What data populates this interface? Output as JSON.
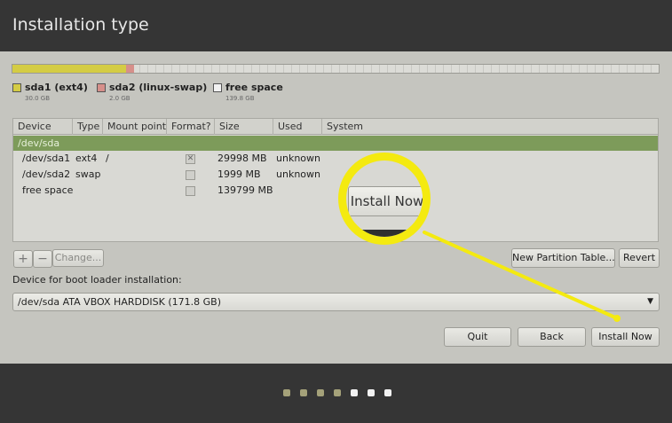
{
  "window": {
    "title": "Installation type"
  },
  "partition_bar": {
    "segments": [
      {
        "name": "sda1 (ext4)",
        "size": "30.0 GB",
        "color": "#d4cc44",
        "fraction": 0.176
      },
      {
        "name": "sda2 (linux-swap)",
        "size": "2.0 GB",
        "color": "#d68f8a",
        "fraction": 0.012
      },
      {
        "name": "free space",
        "size": "139.8 GB",
        "color": "#f2f2f2",
        "fraction": 0.812
      }
    ]
  },
  "table": {
    "headers": [
      "Device",
      "Type",
      "Mount point",
      "Format?",
      "Size",
      "Used",
      "System"
    ],
    "group": "/dev/sda",
    "rows": [
      {
        "device": "/dev/sda1",
        "type": "ext4",
        "mount": "/",
        "format": "✕",
        "size": "29998 MB",
        "used": "unknown"
      },
      {
        "device": "/dev/sda2",
        "type": "swap",
        "mount": "",
        "format": "",
        "size": "1999 MB",
        "used": "unknown"
      },
      {
        "device": "free space",
        "type": "",
        "mount": "",
        "format": "",
        "size": "139799 MB",
        "used": ""
      }
    ]
  },
  "toolbar": {
    "add": "+",
    "remove": "−",
    "change": "Change...",
    "new_table": "New Partition Table...",
    "revert": "Revert"
  },
  "boot": {
    "label": "Device for boot loader installation:",
    "selected": "/dev/sda   ATA VBOX HARDDISK (171.8 GB)"
  },
  "actions": {
    "quit": "Quit",
    "back": "Back",
    "install": "Install Now"
  },
  "callout": {
    "text": "Install Now",
    "color": "#f4ea10"
  },
  "progress": {
    "total": 7,
    "done": 4,
    "done_color": "#a5a27a",
    "todo_color": "#f2f2f2"
  }
}
